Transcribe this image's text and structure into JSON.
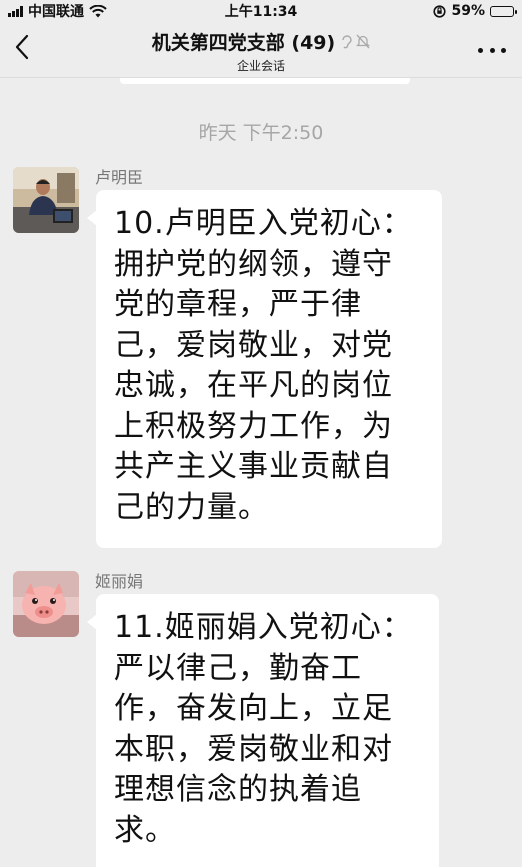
{
  "status_bar": {
    "carrier": "中国联通",
    "time": "上午11:34",
    "battery": "59%",
    "battery_level": 0.59
  },
  "nav": {
    "title": "机关第四党支部 (49)",
    "subtitle": "企业会话"
  },
  "timestamp": "昨天 下午2:50",
  "messages": [
    {
      "sender": "卢明臣",
      "text": "10.卢明臣入党初心：\n拥护党的纲领，遵守\n党的章程，严于律\n己，爱岗敬业，对党\n忠诚，在平凡的岗位\n上积极努力工作，为\n共产主义事业贡献自\n己的力量。"
    },
    {
      "sender": "姬丽娟",
      "text": "11.姬丽娟入党初心：\n严以律己，勤奋工\n作，奋发向上，立足\n本职，爱岗敬业和对\n理想信念的执着追\n求。"
    }
  ]
}
